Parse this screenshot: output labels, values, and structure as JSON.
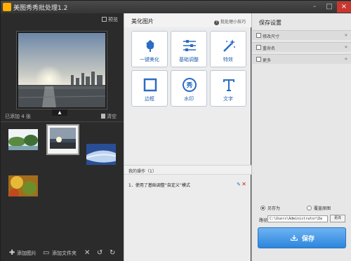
{
  "window": {
    "title": "美图秀秀批处理1.2",
    "controls": [
      "-",
      "□",
      "×"
    ]
  },
  "left": {
    "preview_label": "预览",
    "added_count": "已添加 4 张",
    "clear_label": "清空",
    "add_image_label": "添加图片",
    "add_folder_label": "添加文件夹"
  },
  "middle": {
    "title": "美化图片",
    "tips_label": "批处理小技巧",
    "tiles": [
      {
        "label": "一键美化",
        "icon": "tulip-icon"
      },
      {
        "label": "基础调整",
        "icon": "sliders-icon"
      },
      {
        "label": "特效",
        "icon": "magic-wand-icon"
      },
      {
        "label": "边框",
        "icon": "frame-icon"
      },
      {
        "label": "水印",
        "icon": "watermark-icon"
      },
      {
        "label": "文字",
        "icon": "text-icon"
      }
    ],
    "ops_title": "我的操作（1）",
    "ops": [
      {
        "text": "1．使用了基础调整“自定义”模式"
      }
    ]
  },
  "right": {
    "title": "保存设置",
    "rows": [
      {
        "label": "修改尺寸"
      },
      {
        "label": "重命名"
      },
      {
        "label": "更多"
      }
    ],
    "save_as_label": "另存为",
    "overwrite_label": "覆盖原图",
    "path_label": "路径",
    "path_value": "C:\\Users\\Administrator\\De",
    "change_label": "更改",
    "save_button": "保存"
  },
  "colors": {
    "accent": "#2d86dc",
    "close": "#c8372e",
    "tile_text": "#1f5fae"
  }
}
